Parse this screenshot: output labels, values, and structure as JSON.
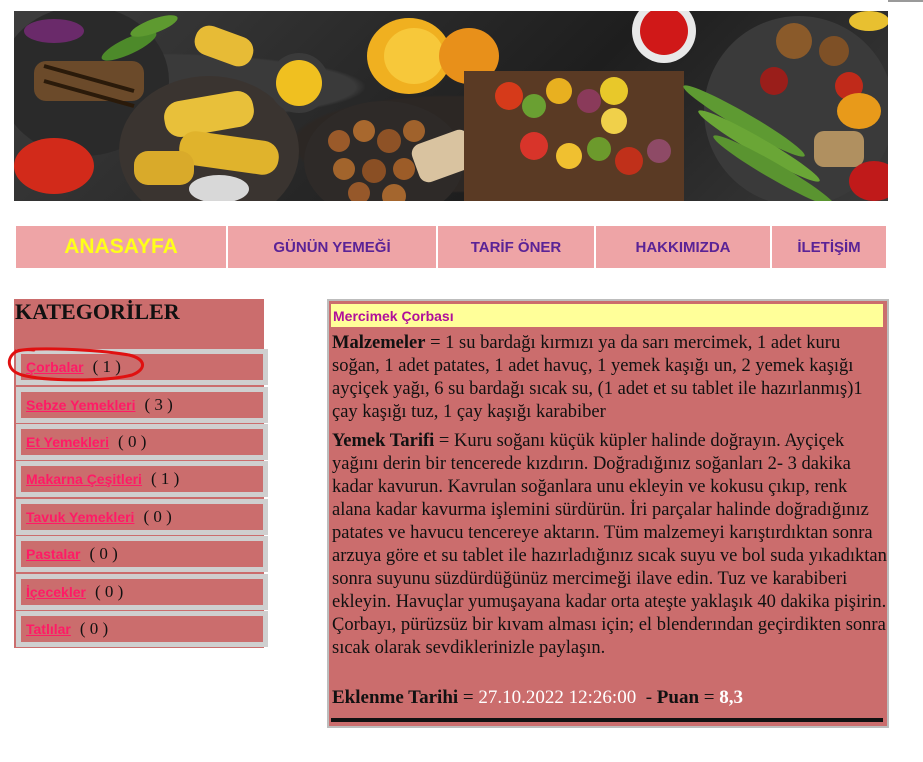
{
  "nav": {
    "items": [
      {
        "label": "ANASAYFA"
      },
      {
        "label": "GÜNÜN YEMEĞİ"
      },
      {
        "label": "TARİF ÖNER"
      },
      {
        "label": "HAKKIMIZDA"
      },
      {
        "label": "İLETİŞİM"
      }
    ]
  },
  "sidebar": {
    "title": "KATEGORİLER",
    "items": [
      {
        "label": "Çorbalar",
        "count": "( 1 )"
      },
      {
        "label": "Sebze Yemekleri",
        "count": "( 3 )"
      },
      {
        "label": "Et Yemekleri",
        "count": "( 0 )"
      },
      {
        "label": "Makarna Çeşitleri",
        "count": "( 1 )"
      },
      {
        "label": "Tavuk Yemekleri",
        "count": "( 0 )"
      },
      {
        "label": "Pastalar",
        "count": "( 0 )"
      },
      {
        "label": "İçecekler",
        "count": "( 0 )"
      },
      {
        "label": "Tatlılar",
        "count": "( 0 )"
      }
    ]
  },
  "recipe": {
    "title": "Mercimek Çorbası",
    "ingredients_label": "Malzemeler",
    "ingredients": "1 su bardağı kırmızı ya da sarı mercimek, 1 adet kuru soğan, 1 adet patates, 1 adet havuç, 1 yemek kaşığı un, 2 yemek kaşığı ayçiçek yağı, 6 su bardağı sıcak su, (1 adet et su tablet ile hazırlanmış)1 çay kaşığı tuz, 1 çay kaşığı karabiber",
    "instructions_label": "Yemek Tarifi",
    "instructions": "Kuru soğanı küçük küpler halinde doğrayın. Ayçiçek yağını derin bir tencerede kızdırın. Doğradığınız soğanları 2- 3 dakika kadar kavurun. Kavrulan soğanlara unu ekleyin ve kokusu çıkıp, renk alana kadar kavurma işlemini sürdürün. İri parçalar halinde doğradığınız patates ve havucu tencereye aktarın. Tüm malzemeyi karıştırdıktan sonra arzuya göre et su tablet ile hazırladığınız sıcak suyu ve bol suda yıkadıktan sonra suyunu süzdürdüğünüz mercimeği ilave edin. Tuz ve karabiberi ekleyin. Havuçlar yumuşayana kadar orta ateşte yaklaşık 40 dakika pişirin. Çorbayı, pürüzsüz bir kıvam alması için; el blenderından geçirdikten sonra sıcak olarak sevdiklerinizle paylaşın.",
    "date_label": "Eklenme Tarihi",
    "date": "27.10.2022 12:26:00",
    "rating_label": "Puan",
    "rating": "8,3"
  },
  "colors": {
    "nav_bg": "#eea4a6",
    "nav_text": "#5a2396",
    "home_text": "#ffff1a",
    "panel_bg": "#cb6d6d",
    "category_link": "#ff1a66",
    "recipe_title": "#b0109a",
    "title_bar": "#ffff99",
    "annotation_circle": "#e01010"
  },
  "icons": {
    "banner": "food-banner-image",
    "annotation": "red-circle-annotation"
  }
}
